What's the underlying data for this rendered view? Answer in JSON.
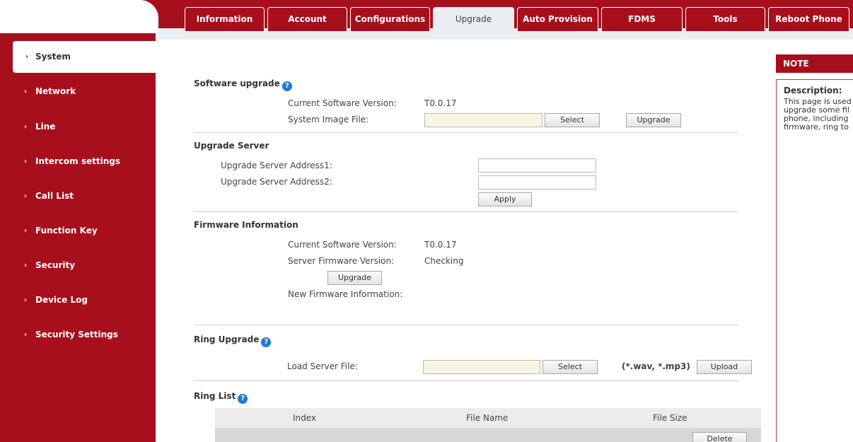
{
  "tabs": [
    {
      "label": "Information",
      "active": false
    },
    {
      "label": "Account",
      "active": false
    },
    {
      "label": "Configurations",
      "active": false
    },
    {
      "label": "Upgrade",
      "active": true
    },
    {
      "label": "Auto Provision",
      "active": false
    },
    {
      "label": "FDMS",
      "active": false
    },
    {
      "label": "Tools",
      "active": false
    },
    {
      "label": "Reboot Phone",
      "active": false
    }
  ],
  "sidebar": {
    "items": [
      {
        "label": "System",
        "active": true
      },
      {
        "label": "Network",
        "active": false
      },
      {
        "label": "Line",
        "active": false
      },
      {
        "label": "Intercom settings",
        "active": false
      },
      {
        "label": "Call List",
        "active": false
      },
      {
        "label": "Function Key",
        "active": false
      },
      {
        "label": "Security",
        "active": false
      },
      {
        "label": "Device Log",
        "active": false
      },
      {
        "label": "Security Settings",
        "active": false
      }
    ]
  },
  "software_upgrade": {
    "title": "Software upgrade",
    "current_version_label": "Current Software Version:",
    "current_version": "T0.0.17",
    "image_file_label": "System Image File:",
    "image_file_value": "",
    "select_button": "Select",
    "upgrade_button": "Upgrade"
  },
  "upgrade_server": {
    "title": "Upgrade Server",
    "address1_label": "Upgrade Server Address1:",
    "address1_value": "",
    "address2_label": "Upgrade Server Address2:",
    "address2_value": "",
    "apply_button": "Apply"
  },
  "firmware_info": {
    "title": "Firmware Information",
    "current_version_label": "Current Software Version:",
    "current_version": "T0.0.17",
    "server_version_label": "Server Firmware Version:",
    "server_version": "Checking",
    "upgrade_button": "Upgrade",
    "new_firmware_label": "New Firmware Information:"
  },
  "ring_upgrade": {
    "title": "Ring Upgrade",
    "load_file_label": "Load Server File:",
    "load_file_value": "",
    "select_button": "Select",
    "formats": "(*.wav, *.mp3)",
    "upload_button": "Upload"
  },
  "ring_list": {
    "title": "Ring List",
    "columns": [
      "Index",
      "File Name",
      "File Size"
    ],
    "delete_button": "Delete"
  },
  "note": {
    "header": "NOTE",
    "title": "Description:",
    "text": "This page is used\nupgrade some fil\nphone, including\nfirmware, ring to"
  },
  "colors": {
    "brand_red": "#a80f1c",
    "help_blue": "#1f7bd6"
  }
}
